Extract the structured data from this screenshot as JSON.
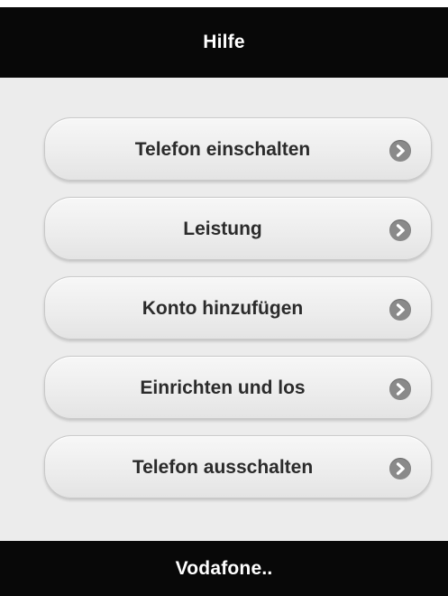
{
  "header": {
    "title": "Hilfe"
  },
  "menu": {
    "items": [
      {
        "label": "Telefon einschalten",
        "icon": "chevron-right-circle-icon"
      },
      {
        "label": "Leistung",
        "icon": "chevron-right-circle-icon"
      },
      {
        "label": "Konto hinzufügen",
        "icon": "chevron-right-circle-icon"
      },
      {
        "label": "Einrichten und los",
        "icon": "chevron-right-circle-icon"
      },
      {
        "label": "Telefon ausschalten",
        "icon": "chevron-right-circle-icon"
      }
    ]
  },
  "footer": {
    "title": "Vodafone.."
  },
  "colors": {
    "bar_background": "#080808",
    "page_background": "#ececec",
    "button_text": "#2b2b2b",
    "icon_background": "#8a8a8a"
  }
}
